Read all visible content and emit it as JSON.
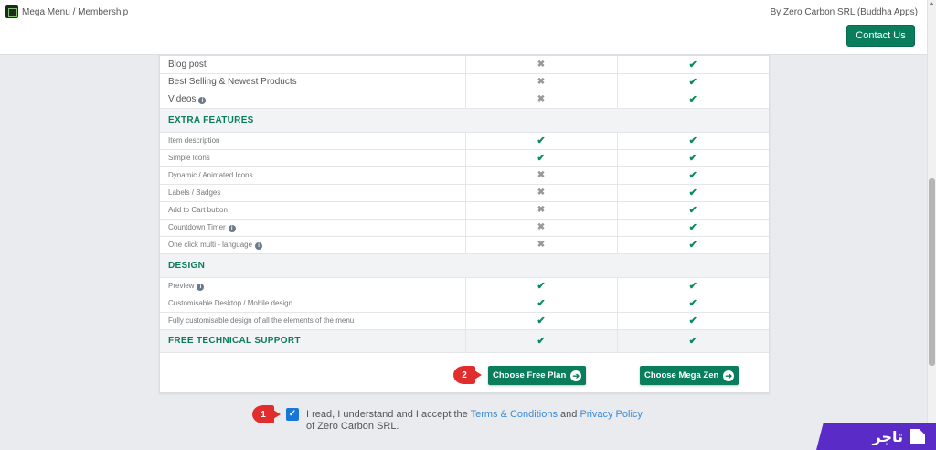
{
  "header": {
    "title": "Mega Menu / Membership",
    "author": "By Zero Carbon SRL (Buddha Apps)",
    "contact_label": "Contact Us"
  },
  "table": {
    "top_rows": [
      {
        "label": "Blog post",
        "free": "x",
        "zen": "check"
      },
      {
        "label": "Best Selling & Newest Products",
        "free": "x",
        "zen": "check"
      },
      {
        "label": "Videos",
        "info": true,
        "free": "x",
        "zen": "check"
      }
    ],
    "sections": [
      {
        "title": "EXTRA FEATURES",
        "rows": [
          {
            "label": "Item description",
            "free": "check",
            "zen": "check"
          },
          {
            "label": "Simple Icons",
            "free": "check",
            "zen": "check"
          },
          {
            "label": "Dynamic / Animated Icons",
            "free": "x",
            "zen": "check"
          },
          {
            "label": "Labels / Badges",
            "free": "x",
            "zen": "check"
          },
          {
            "label": "Add to Cart button",
            "free": "x",
            "zen": "check"
          },
          {
            "label": "Countdown Timer",
            "info": true,
            "free": "x",
            "zen": "check"
          },
          {
            "label": "One click multi - language",
            "info": true,
            "free": "x",
            "zen": "check"
          }
        ]
      },
      {
        "title": "DESIGN",
        "rows": [
          {
            "label": "Preview",
            "info": true,
            "free": "check",
            "zen": "check"
          },
          {
            "label": "Customisable Desktop / Mobile design",
            "free": "check",
            "zen": "check"
          },
          {
            "label": "Fully customisable design of all the elements of the menu",
            "free": "check",
            "zen": "check"
          }
        ]
      }
    ],
    "support": {
      "label": "FREE TECHNICAL SUPPORT",
      "free": "check",
      "zen": "check"
    }
  },
  "buttons": {
    "free_plan": "Choose Free Plan",
    "mega_zen": "Choose Mega Zen"
  },
  "annotations": {
    "badge1": "1",
    "badge2": "2"
  },
  "agreement": {
    "text_before": "I read, I understand and I accept the ",
    "terms_link": "Terms & Conditions",
    "text_middle": " and ",
    "privacy_link": "Privacy Policy",
    "text_after": " of Zero Carbon SRL.",
    "checked": true
  },
  "watermark": {
    "text": "تاجر",
    "brand_color": "#5b2bc8"
  },
  "colors": {
    "accent": "#0a7d5c",
    "link": "#3b8ad9",
    "badge": "#e22d2d",
    "checkbox": "#1677d9"
  }
}
